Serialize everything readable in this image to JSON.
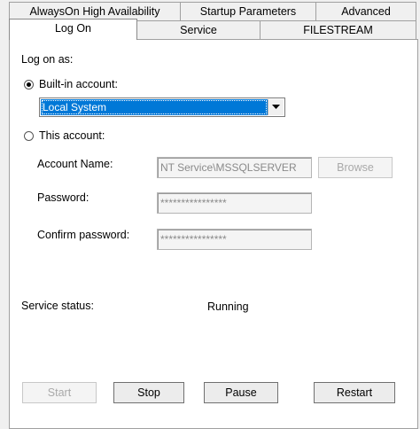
{
  "tabs": {
    "row1": [
      {
        "label": "AlwaysOn High Availability"
      },
      {
        "label": "Startup Parameters"
      },
      {
        "label": "Advanced"
      }
    ],
    "row2": [
      {
        "label": "Log On",
        "active": true
      },
      {
        "label": "Service"
      },
      {
        "label": "FILESTREAM"
      }
    ]
  },
  "logon": {
    "group_label": "Log on as:",
    "builtin_label": "Built-in account:",
    "builtin_selected": true,
    "builtin_value": "Local System",
    "this_account_label": "This account:",
    "account_name_label": "Account Name:",
    "account_name_value": "NT Service\\MSSQLSERVER",
    "browse_label": "Browse",
    "password_label": "Password:",
    "password_value": "****************",
    "confirm_label": "Confirm password:",
    "confirm_value": "****************"
  },
  "status": {
    "label": "Service status:",
    "value": "Running"
  },
  "buttons": {
    "start": "Start",
    "stop": "Stop",
    "pause": "Pause",
    "restart": "Restart"
  },
  "colors": {
    "selection": "#0078d7",
    "window_bg": "#f0f0f0"
  },
  "icons": {
    "dropdown": "chevron-down-icon",
    "radio_selected": "radio-selected-icon",
    "radio_unselected": "radio-unselected-icon"
  }
}
